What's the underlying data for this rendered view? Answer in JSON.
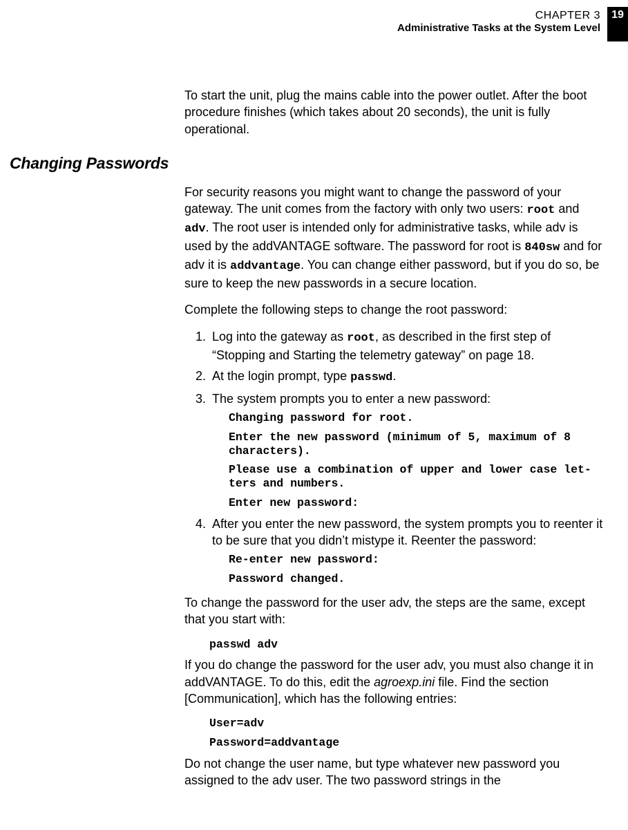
{
  "header": {
    "chapter_label": "CHAPTER 3",
    "page_number": "19",
    "subtitle": "Administrative Tasks at the System Level"
  },
  "intro_para": "To start the unit, plug the mains cable into the power outlet. After the boot procedure finishes (which takes about 20 seconds), the unit is fully operational.",
  "section_heading": "Changing Passwords",
  "p1_a": "For security reasons you might want to change the password of your gateway. The unit comes from the factory with only two users: ",
  "p1_root": "root",
  "p1_b": " and ",
  "p1_adv": "adv",
  "p1_c": ". The root user is intended only for administrative tasks, while adv is used by the addVANTAGE software. The pass­word for root is ",
  "p1_840sw": "840sw",
  "p1_d": " and for adv it is ",
  "p1_addv": "addvantage",
  "p1_e": ". You can change either password, but if you do so, be sure to keep the new passwords in a secure location.",
  "p2": "Complete the following steps to change the root password:",
  "steps": {
    "s1_a": "Log into the gateway as ",
    "s1_root": "root",
    "s1_b": ", as described in the first step of “Stopping and Starting the telemetry gateway” on page 18.",
    "s2_a": "At the login prompt, type ",
    "s2_passwd": "passwd",
    "s2_b": ".",
    "s3": "The system prompts you to enter a new password:",
    "s3_code": {
      "l1": "Changing password for root.",
      "l2": "Enter the new password (minimum of 5, maximum of 8 characters).",
      "l3": "Please use a combination of upper and lower case let­ters and numbers.",
      "l4": "Enter new password:"
    },
    "s4": "After you enter the new password, the system prompts you to reenter it to be sure that you didn’t mistype it. Reenter the password:",
    "s4_code": {
      "l1": "Re-enter new password:",
      "l2": "Password changed."
    }
  },
  "p3": "To change the password for the user adv, the steps are the same, except that you start with:",
  "code_passwd_adv": "passwd adv",
  "p4_a": "If you do change the password for the user adv, you must also change it in addVANTAGE. To do this, edit the ",
  "p4_file": "agroexp.ini",
  "p4_b": " file. Find the section [Communication], which has the following entries:",
  "code_ini": {
    "l1": "User=adv",
    "l2": "Password=addvantage"
  },
  "p5": "Do not change the user name, but type whatever new password you assigned to the adv user. The two password strings in the"
}
